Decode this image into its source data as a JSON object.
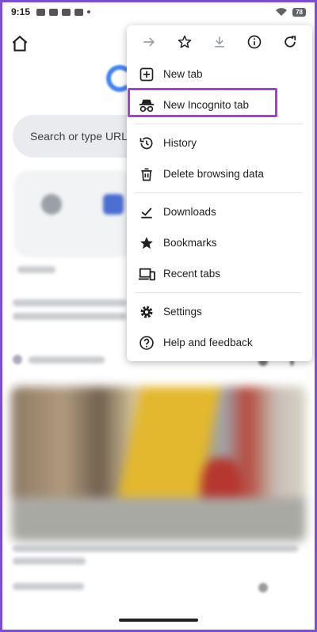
{
  "status_bar": {
    "time": "9:15",
    "battery": "78"
  },
  "page": {
    "search_placeholder": "Search or type URL"
  },
  "menu": {
    "toolbar": [
      "forward-icon",
      "star-icon",
      "download-icon",
      "info-icon",
      "refresh-icon"
    ],
    "items": [
      {
        "label": "New tab",
        "icon": "plus-box-icon"
      },
      {
        "label": "New Incognito tab",
        "icon": "incognito-icon"
      },
      {
        "label": "History",
        "icon": "history-icon"
      },
      {
        "label": "Delete browsing data",
        "icon": "trash-icon"
      },
      {
        "label": "Downloads",
        "icon": "download-check-icon"
      },
      {
        "label": "Bookmarks",
        "icon": "bookmark-star-icon"
      },
      {
        "label": "Recent tabs",
        "icon": "devices-icon"
      },
      {
        "label": "Settings",
        "icon": "gear-icon"
      },
      {
        "label": "Help and feedback",
        "icon": "help-icon"
      }
    ]
  },
  "colors": {
    "highlight": "#a43ee0",
    "frame": "#7c4ddb"
  }
}
